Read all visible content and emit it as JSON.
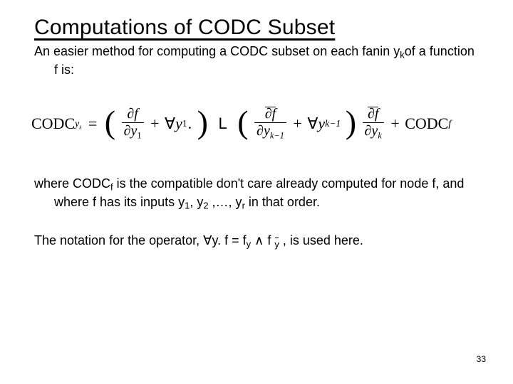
{
  "slide": {
    "title": "Computations of CODC Subset",
    "intro_a": "An easier method for computing a CODC subset on each fanin y",
    "intro_k": "k",
    "intro_b": "of a function f is:",
    "formula": {
      "codc": "CODC",
      "sub_yk": "y",
      "sub_yk_k": "k",
      "equals": "=",
      "lparen": "(",
      "rparen": ")",
      "partial": "∂",
      "f": "f",
      "y1": "y",
      "one": "1",
      "plus": "+",
      "forall": "∀",
      "dot": ".",
      "Lop": "L",
      "ykm1_y": "y",
      "ykm1_km1": "k−1",
      "yk_y": "y",
      "yk_k": "k",
      "codcf": "CODC",
      "codcf_f": "f"
    },
    "where_a": "where CODC",
    "where_f": "f",
    "where_b": " is the compatible don't care already computed for node f, and where f has its inputs y",
    "where_1": "1",
    "where_c": ", y",
    "where_2": "2",
    "where_d": " ,…, y",
    "where_r": "r",
    "where_e": " in that order.",
    "notation_a": "The notation for the operator,  ",
    "notation_forall": "∀",
    "notation_b": "y. f = f",
    "notation_y": "y",
    "notation_and": " ∧ f ",
    "notation_ybar": "y",
    "notation_c": " , is used here.",
    "page_number": "33"
  }
}
